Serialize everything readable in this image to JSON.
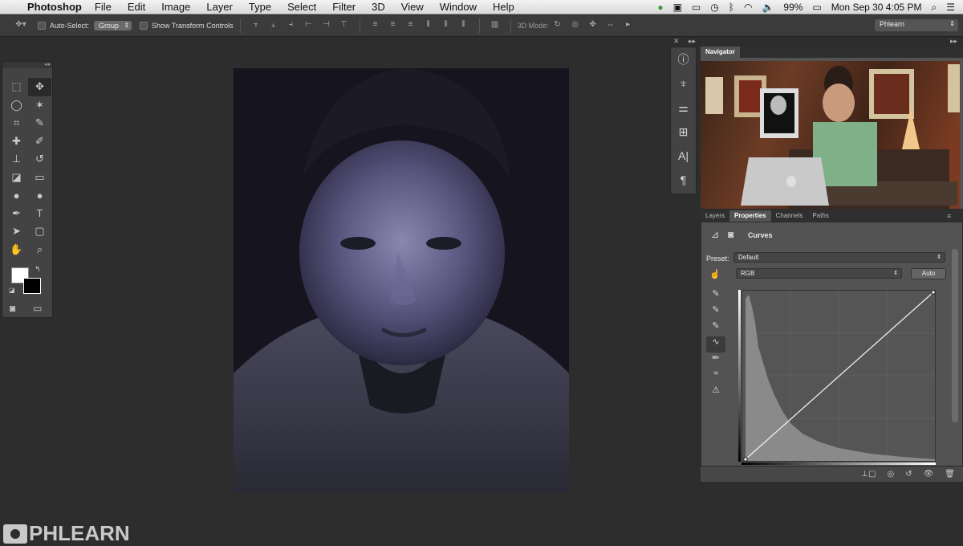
{
  "menubar": {
    "app": "Photoshop",
    "items": [
      "File",
      "Edit",
      "Image",
      "Layer",
      "Type",
      "Select",
      "Filter",
      "3D",
      "View",
      "Window",
      "Help"
    ],
    "battery": "99%",
    "clock": "Mon Sep 30  4:05 PM"
  },
  "options": {
    "auto_select_label": "Auto-Select:",
    "auto_select_value": "Group",
    "show_transform_label": "Show Transform Controls",
    "mode_3d_label": "3D Mode:",
    "workspace": "Phlearn"
  },
  "navigator": {
    "tab": "Navigator"
  },
  "panel_tabs": [
    "Layers",
    "Properties",
    "Channels",
    "Paths"
  ],
  "properties": {
    "title": "Curves",
    "preset_label": "Preset:",
    "preset_value": "Default",
    "channel_value": "RGB",
    "auto_label": "Auto"
  },
  "watermark": "PHLEARN",
  "colors": {
    "foreground": "#ffffff",
    "background": "#000000",
    "panel": "#535353",
    "app_bg": "#2d2d2d"
  }
}
